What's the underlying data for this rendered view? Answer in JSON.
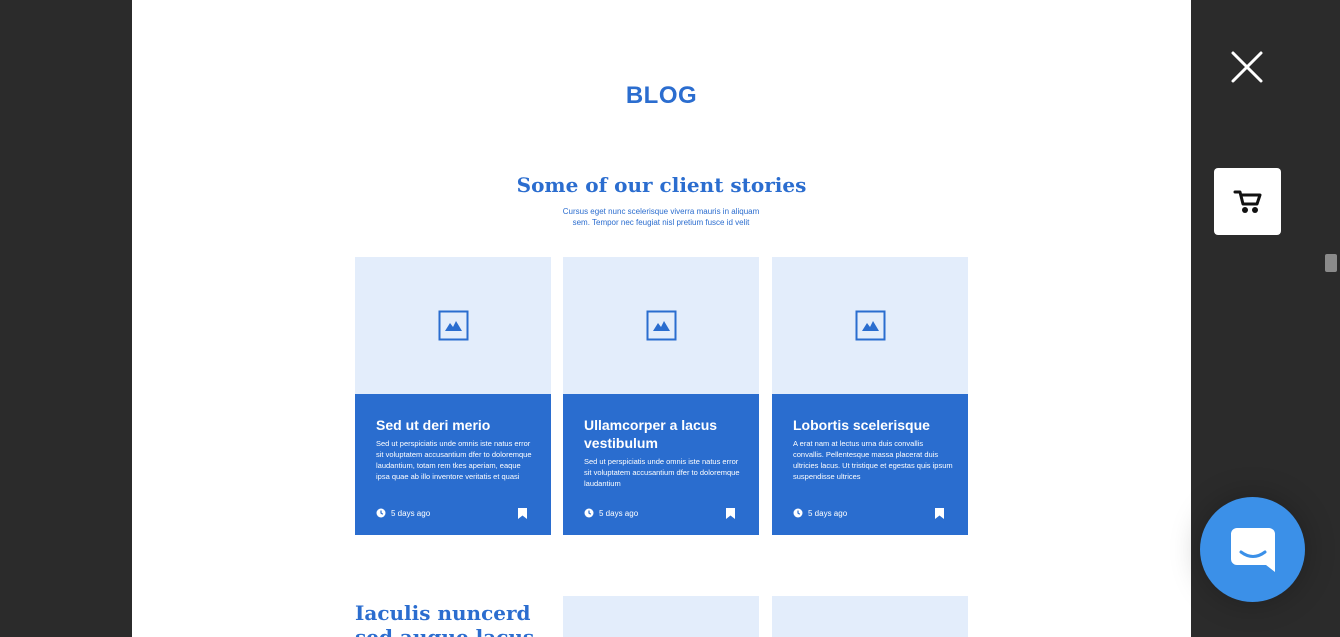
{
  "colors": {
    "accent": "#2a6dcf",
    "thumb_bg": "#e3edfb",
    "backdrop": "#2b2b2b",
    "chat": "#3b90e8"
  },
  "blog": {
    "title": "BLOG",
    "heading": "Some of our client stories",
    "subtitle": "Cursus eget nunc scelerisque viverra mauris in aliquam sem. Tempor nec feugiat nisl pretium fusce id velit"
  },
  "cards": [
    {
      "title": "Sed ut deri merio",
      "text": "Sed ut perspiciatis unde omnis iste natus error sit voluptatem accusantium dfer to doloremque laudantium, totam rem tkes aperiam, eaque ipsa quae ab illo inventore veritatis et quasi",
      "meta": "5 days ago",
      "icon": "image-placeholder-icon"
    },
    {
      "title": "Ullamcorper a lacus vestibulum",
      "text": "Sed ut perspiciatis unde omnis iste natus error sit voluptatem accusantium dfer to doloremque laudantium",
      "meta": "5 days ago",
      "icon": "image-placeholder-icon"
    },
    {
      "title": "Lobortis scelerisque",
      "text": "A erat nam at lectus urna duis convallis convallis. Pellentesque massa placerat duis ultricies lacus. Ut tristique et egestas quis ipsum suspendisse ultrices",
      "meta": "5 days ago",
      "icon": "image-placeholder-icon"
    }
  ],
  "next_section": {
    "heading": "Iaculis nuncerd sed augue lacus"
  },
  "controls": {
    "close_icon": "close-icon",
    "cart_icon": "cart-icon",
    "chat_icon": "chat-icon"
  }
}
